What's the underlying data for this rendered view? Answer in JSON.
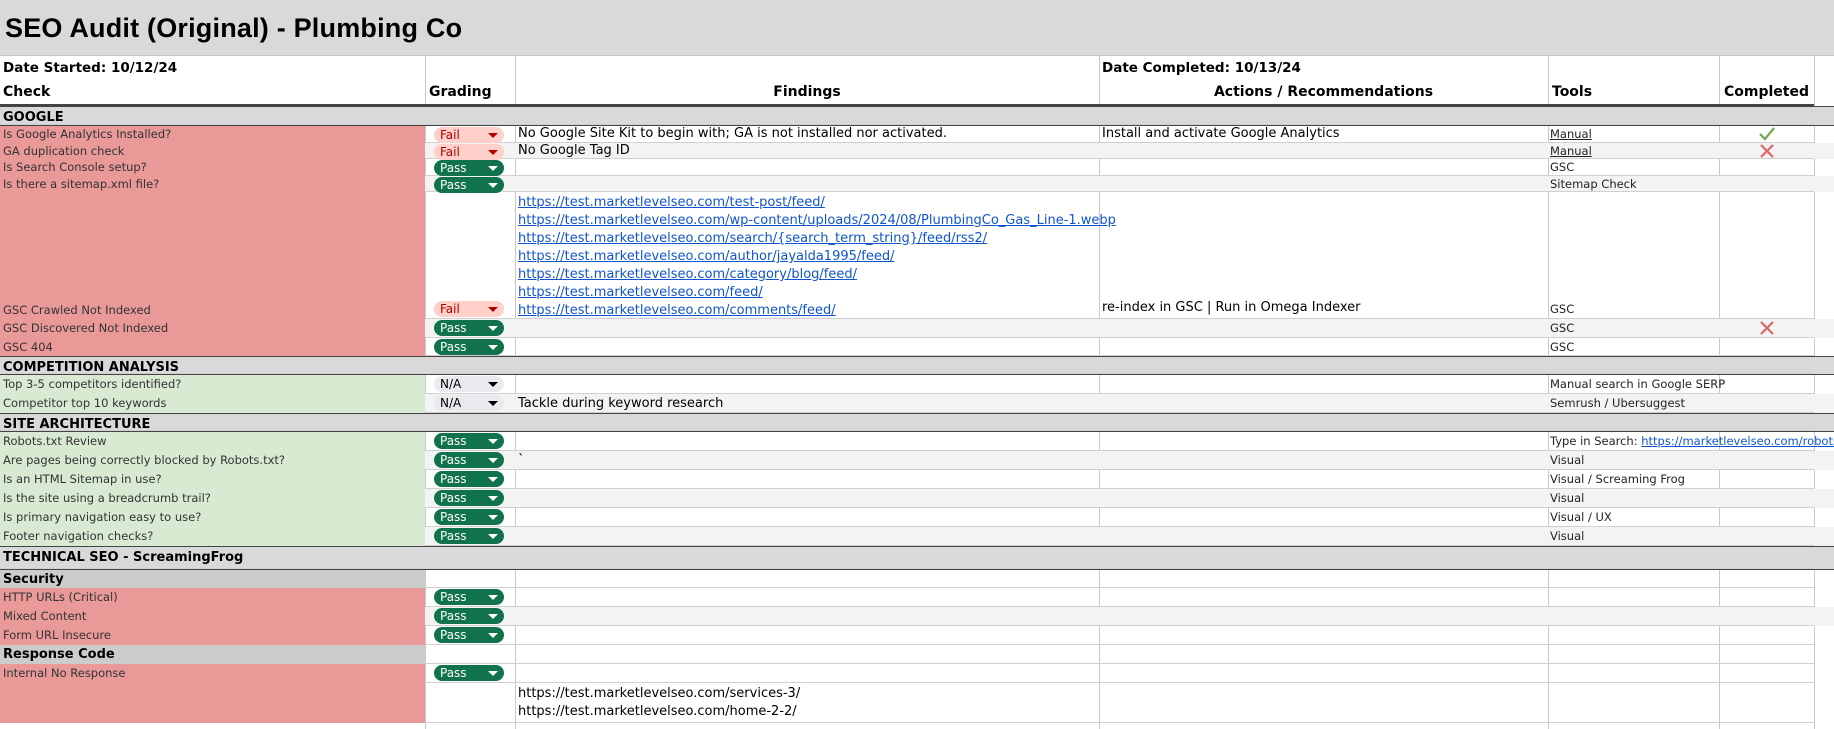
{
  "title": "SEO Audit (Original) - Plumbing Co",
  "date_started": "Date Started: 10/12/24",
  "date_completed": "Date Completed: 10/13/24",
  "headers": {
    "check": "Check",
    "grading": "Grading",
    "findings": "Findings",
    "actions": "Actions / Recommendations",
    "tools": "Tools",
    "completed": "Completed"
  },
  "sections": {
    "google": "GOOGLE",
    "competition": "COMPETITION ANALYSIS",
    "architecture": "SITE ARCHITECTURE",
    "technical": "TECHNICAL SEO - ScreamingFrog",
    "security": "Security",
    "response": "Response Code"
  },
  "google_rows": [
    {
      "check": "Is Google Analytics Installed?",
      "grade": "Fail",
      "finding": "No Google Site Kit to begin with; GA is not installed nor activated.",
      "action": "Install and activate Google Analytics",
      "tool": "Manual",
      "completed": "check"
    },
    {
      "check": "GA duplication check",
      "grade": "Fail",
      "finding": "No Google Tag ID",
      "action": "",
      "tool": "Manual",
      "completed": "cross"
    },
    {
      "check": "Is Search Console setup?",
      "grade": "Pass",
      "finding": "",
      "action": "",
      "tool": "GSC",
      "completed": ""
    },
    {
      "check": "Is there a sitemap.xml file?",
      "grade": "Pass",
      "finding": "",
      "action": "",
      "tool": "Sitemap Check",
      "completed": ""
    }
  ],
  "gsc_links": [
    "https://test.marketlevelseo.com/test-post/feed/",
    "https://test.marketlevelseo.com/wp-content/uploads/2024/08/PlumbingCo_Gas_Line-1.webp",
    "https://test.marketlevelseo.com/search/{search_term_string}/feed/rss2/",
    "https://test.marketlevelseo.com/author/jayalda1995/feed/",
    "https://test.marketlevelseo.com/category/blog/feed/",
    "https://test.marketlevelseo.com/feed/",
    "https://test.marketlevelseo.com/comments/feed/"
  ],
  "gsc_rows": [
    {
      "check": "GSC Crawled Not Indexed",
      "grade": "Fail",
      "action": "re-index in GSC | Run in Omega Indexer",
      "tool": "GSC",
      "completed": ""
    },
    {
      "check": "GSC Discovered Not Indexed",
      "grade": "Pass",
      "action": "",
      "tool": "GSC",
      "completed": "cross"
    },
    {
      "check": "GSC 404",
      "grade": "Pass",
      "action": "",
      "tool": "GSC",
      "completed": ""
    }
  ],
  "competition_rows": [
    {
      "check": "Top 3-5 competitors identified?",
      "grade": "N/A",
      "finding": "",
      "tool": "Manual search in Google SERP"
    },
    {
      "check": "Competitor top 10 keywords",
      "grade": "N/A",
      "finding": "Tackle during keyword research",
      "tool": "Semrush / Ubersuggest"
    }
  ],
  "architecture_rows": [
    {
      "check": "Robots.txt Review",
      "grade": "Pass",
      "finding": "",
      "tool": "Type in Search: ",
      "tool_link": "https://marketlevelseo.com/robots.txt"
    },
    {
      "check": "Are pages being correctly blocked by Robots.txt?",
      "grade": "Pass",
      "finding": "`",
      "tool": "Visual",
      "tool_link": ""
    },
    {
      "check": "Is an HTML Sitemap in use?",
      "grade": "Pass",
      "finding": "",
      "tool": "Visual / Screaming Frog",
      "tool_link": ""
    },
    {
      "check": "Is the site using a breadcrumb trail?",
      "grade": "Pass",
      "finding": "",
      "tool": "Visual",
      "tool_link": ""
    },
    {
      "check": "Is primary navigation easy to use?",
      "grade": "Pass",
      "finding": "",
      "tool": "Visual / UX",
      "tool_link": ""
    },
    {
      "check": "Footer navigation checks?",
      "grade": "Pass",
      "finding": "",
      "tool": "Visual",
      "tool_link": ""
    }
  ],
  "security_rows": [
    {
      "check": "HTTP URLs (Critical)",
      "grade": "Pass"
    },
    {
      "check": "Mixed Content",
      "grade": "Pass"
    },
    {
      "check": "Form URL Insecure",
      "grade": "Pass"
    }
  ],
  "response_rows": [
    {
      "check": "Internal No Response",
      "grade": "Pass"
    }
  ],
  "response_findings": [
    "https://test.marketlevelseo.com/services-3/",
    "https://test.marketlevelseo.com/home-2-2/"
  ],
  "colors": {
    "fail_bg": "#ea9999",
    "pass_bg": "#d9ead3",
    "pill_pass": "#11734b",
    "pill_fail": "#ffcfc9",
    "section": "#d9d9d9"
  }
}
